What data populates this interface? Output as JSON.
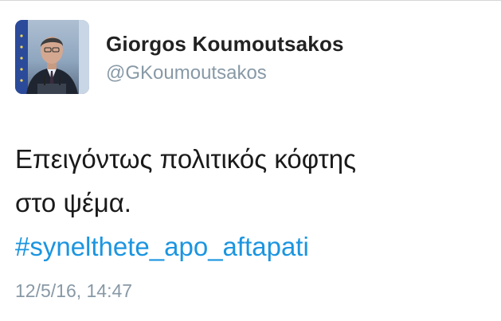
{
  "tweet": {
    "author": {
      "display_name": "Giorgos Koumoutsakos",
      "handle": "@GKoumoutsakos",
      "avatar_icon": "profile-photo"
    },
    "text_lines": [
      "Επειγόντως πολιτικός κόφτης",
      "στο ψέμα."
    ],
    "hashtag": "#synelthete_apo_aftapati",
    "timestamp": "12/5/16, 14:47"
  },
  "colors": {
    "link": "#1b95e0",
    "secondary_text": "#8899a6",
    "primary_text": "#1a1a1a"
  }
}
